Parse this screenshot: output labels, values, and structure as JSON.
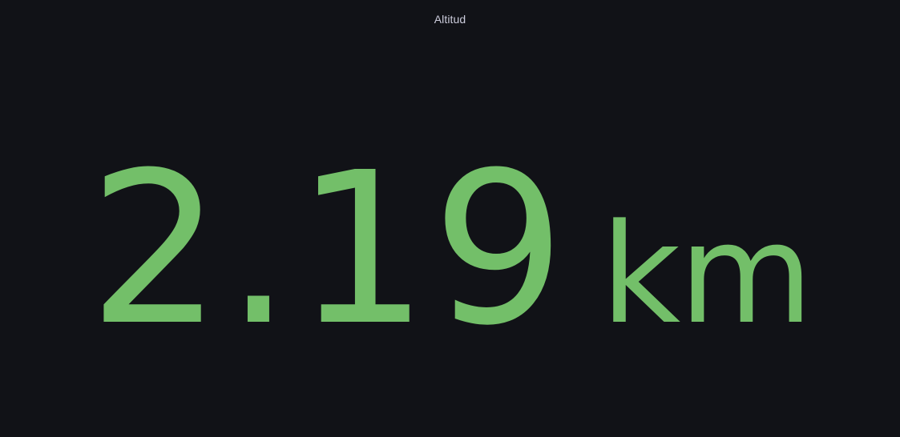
{
  "panel": {
    "title": "Altitud"
  },
  "stat": {
    "value": "2.19",
    "unit": "km",
    "color": "#73bf69"
  },
  "colors": {
    "background": "#111217",
    "title": "#ccccdc",
    "value": "#73bf69"
  }
}
